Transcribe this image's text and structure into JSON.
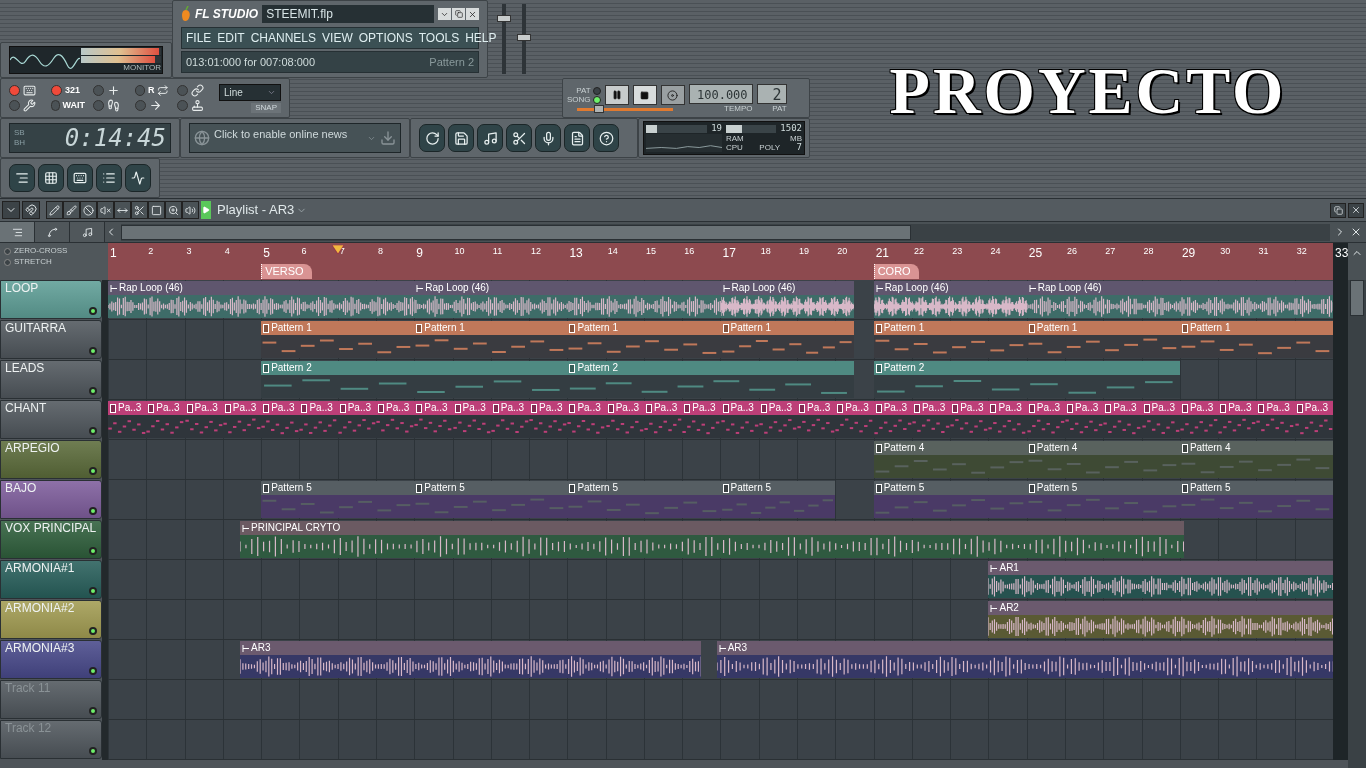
{
  "title_bar": {
    "app": "FL STUDIO",
    "file": "STEEMIT.flp"
  },
  "menu": [
    "FILE",
    "EDIT",
    "CHANNELS",
    "VIEW",
    "OPTIONS",
    "TOOLS",
    "HELP"
  ],
  "hint_bar": {
    "text": "013:01:000 for 007:08:000",
    "pattern": "Pattern 2"
  },
  "monitor": {
    "label": "MONITOR",
    "meters": [
      {
        "level": 0.97
      },
      {
        "level": 0.92
      }
    ]
  },
  "faders": [
    {
      "level": 0.82
    },
    {
      "level": 0.52
    }
  ],
  "toggles": [
    {
      "on": true
    },
    {
      "on": true,
      "label": "321"
    },
    {
      "on": false
    },
    {
      "on": false,
      "label": "R"
    },
    {
      "on": false
    },
    {
      "on": false
    },
    {
      "on": false,
      "label": "WAIT"
    },
    {
      "on": false
    },
    {
      "on": false
    },
    {
      "on": false
    }
  ],
  "snap": {
    "value": "Line",
    "label": "SNAP"
  },
  "transport": {
    "modes": [
      {
        "label": "PAT",
        "selected": false
      },
      {
        "label": "SONG",
        "selected": true
      }
    ],
    "pitch": {
      "level": 0.2
    },
    "tempo": "100.000",
    "tempo_label": "TEMPO",
    "pattern": "2",
    "pattern_label": "PAT"
  },
  "clock": {
    "time": "0:14:45",
    "top_label": "SB",
    "bottom_label": "BH"
  },
  "news": {
    "text": "Click to enable online news"
  },
  "cpu_panel": {
    "cpu_value": "19",
    "cpu_bar": {
      "level": 0.18
    },
    "ram_value": "1502",
    "ram_bar": {
      "level": 0.32
    },
    "ram_label": "RAM",
    "mb_label": "MB",
    "cpu_label": "CPU",
    "poly_label": "POLY",
    "poly_value": "7"
  },
  "overlay_title": "PROYECTO",
  "playlist": {
    "title": "Playlist - AR3",
    "tabs": [
      {
        "selected": true
      },
      {
        "selected": false
      },
      {
        "selected": false
      }
    ],
    "options": [
      {
        "label": "ZERO-CROSS",
        "on": false
      },
      {
        "label": "STRETCH",
        "on": false
      }
    ],
    "ruler": [
      "1",
      "2",
      "3",
      "4",
      "5",
      "6",
      "7",
      "8",
      "9",
      "10",
      "11",
      "12",
      "13",
      "14",
      "15",
      "16",
      "17",
      "18",
      "19",
      "20",
      "21",
      "22",
      "23",
      "24",
      "25",
      "26",
      "27",
      "28",
      "29",
      "30",
      "31",
      "32",
      "33"
    ],
    "markers": [
      {
        "label": "VERSO"
      },
      {
        "label": "CORO"
      }
    ],
    "playhead": {
      "level": 0.1875
    },
    "tracks": [
      {
        "name": "LOOP",
        "kind": "audio",
        "color": "#5e9e96",
        "on": true,
        "header": {
          "color": "#5f566e"
        },
        "body": {
          "color": "#3e6c68"
        },
        "clips": [
          "Rap Loop (46)",
          "Rap Loop (46)",
          "Rap Loop (46)",
          "Rap Loop (46)",
          "Rap Loop (46)"
        ]
      },
      {
        "name": "GUITARRA",
        "kind": "pattern",
        "color": "#50575d",
        "on": true,
        "header": {
          "color": "#c0785a"
        },
        "body": {
          "color": "#3a3b40"
        },
        "clips": [
          "Pattern 1",
          "Pattern 1",
          "Pattern 1",
          "Pattern 1",
          "Pattern 1",
          "Pattern 1",
          "Pattern 1"
        ]
      },
      {
        "name": "LEADS",
        "kind": "pattern",
        "color": "#50575d",
        "on": true,
        "header": {
          "color": "#4f8a82"
        },
        "body": {
          "color": "#343d42"
        },
        "clips": [
          "Pattern 2",
          "Pattern 2",
          "Pattern 2"
        ]
      },
      {
        "name": "CHANT",
        "kind": "pattern",
        "color": "#50575d",
        "on": true,
        "header": {
          "color": "#bd3f78"
        },
        "body": {
          "color": "#2f353b"
        },
        "clips": [
          "Pa..3",
          "Pa..3",
          "Pa..3",
          "Pa..3",
          "Pa..3",
          "Pa..3",
          "Pa..3",
          "Pa..3",
          "Pa..3",
          "Pa..3",
          "Pa..3",
          "Pa..3",
          "Pa..3",
          "Pa..3",
          "Pa..3",
          "Pa..3",
          "Pa..3",
          "Pa..3",
          "Pa..3",
          "Pa..3",
          "Pa..3",
          "Pa..3",
          "Pa..3",
          "Pa..3",
          "Pa..3",
          "Pa..3",
          "Pa..3",
          "Pa..3",
          "Pa..3",
          "Pa..3",
          "Pa..3",
          "Pa..3"
        ]
      },
      {
        "name": "ARPEGIO",
        "kind": "pattern",
        "color": "#5b6b3a",
        "on": true,
        "header": {
          "color": "#59625e"
        },
        "body": {
          "color": "#3e4a34"
        },
        "clips": [
          "Pattern 4",
          "Pattern 4",
          "Pattern 4"
        ]
      },
      {
        "name": "BAJO",
        "kind": "pattern",
        "color": "#7e5d9c",
        "on": true,
        "header": {
          "color": "#565e63"
        },
        "body": {
          "color": "#4a3a66"
        },
        "clips": [
          "Pattern 5",
          "Pattern 5",
          "Pattern 5",
          "Pattern 5",
          "Pattern 5",
          "Pattern 5",
          "Pattern 5"
        ]
      },
      {
        "name": "VOX PRINCIPAL",
        "kind": "audio",
        "color": "#2f5f3c",
        "on": true,
        "header": {
          "color": "#6b5a62"
        },
        "body": {
          "color": "#2f5a40"
        },
        "clips": [
          "PRINCIPAL CRYTO"
        ]
      },
      {
        "name": "ARMONIA#1",
        "kind": "audio",
        "color": "#285f5b",
        "on": true,
        "header": {
          "color": "#6b5a6e"
        },
        "body": {
          "color": "#26524f"
        },
        "clips": [
          "AR1"
        ]
      },
      {
        "name": "ARMONIA#2",
        "kind": "audio",
        "color": "#a29c52",
        "on": true,
        "header": {
          "color": "#6b5a6e"
        },
        "body": {
          "color": "#5a5a34"
        },
        "clips": [
          "AR2"
        ]
      },
      {
        "name": "ARMONIA#3",
        "kind": "audio",
        "color": "#48498a",
        "on": true,
        "header": {
          "color": "#6b5a6e"
        },
        "body": {
          "color": "#363866"
        },
        "clips": [
          "AR3",
          "AR3"
        ]
      },
      {
        "name": "Track 11",
        "kind": "empty",
        "color": "#50575d",
        "on": true
      },
      {
        "name": "Track 12",
        "kind": "empty",
        "color": "#50575d",
        "on": true
      }
    ]
  }
}
